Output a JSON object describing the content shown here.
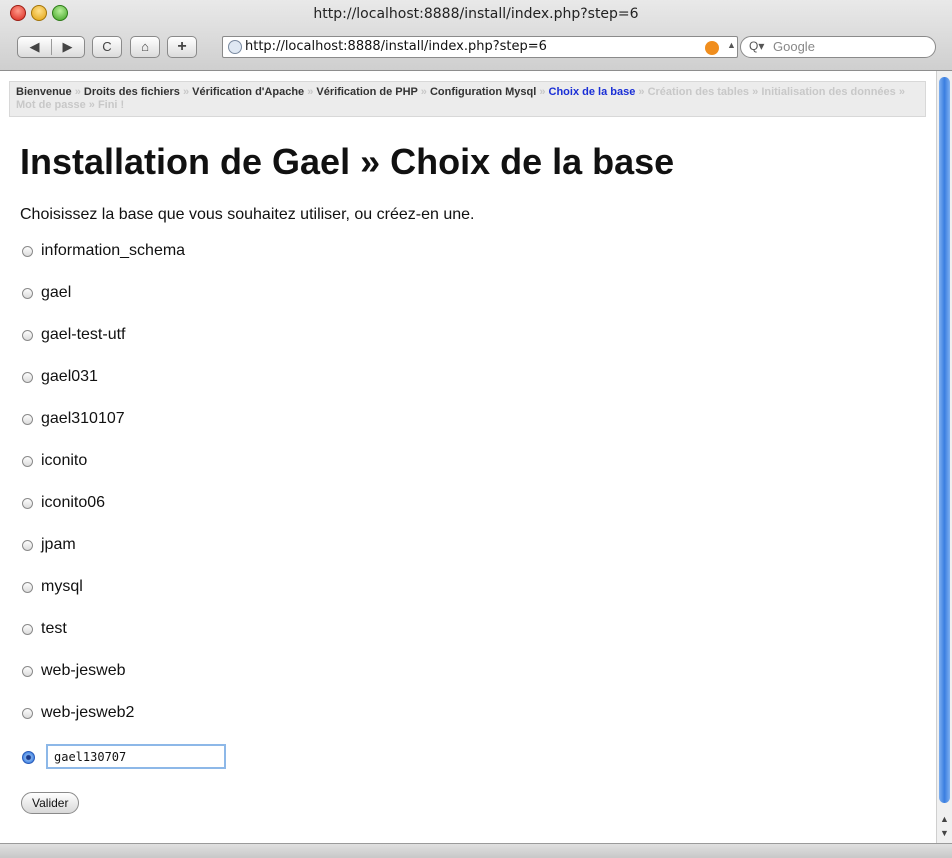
{
  "browser": {
    "window_title": "http://localhost:8888/install/index.php?step=6",
    "url": "http://localhost:8888/install/index.php?step=6",
    "search_placeholder": "Google",
    "back_glyph": "◀",
    "forward_glyph": "▶",
    "reload_glyph": "C",
    "home_glyph": "⌂",
    "add_glyph": "+"
  },
  "breadcrumb": {
    "items": [
      {
        "label": "Bienvenue",
        "state": "done"
      },
      {
        "label": "Droits des fichiers",
        "state": "done"
      },
      {
        "label": "Vérification d'Apache",
        "state": "done"
      },
      {
        "label": "Vérification de PHP",
        "state": "done"
      },
      {
        "label": "Configuration Mysql",
        "state": "done"
      },
      {
        "label": "Choix de la base",
        "state": "current"
      },
      {
        "label": "Création des tables",
        "state": "future"
      },
      {
        "label": "Initialisation des données",
        "state": "future"
      },
      {
        "label": "Mot de passe",
        "state": "future"
      },
      {
        "label": "Fini !",
        "state": "future"
      }
    ],
    "separator": "»"
  },
  "page": {
    "title": "Installation de Gael » Choix de la base",
    "intro": "Choisissez la base que vous souhaitez utiliser, ou créez-en une."
  },
  "databases": [
    "information_schema",
    "gael",
    "gael-test-utf",
    "gael031",
    "gael310107",
    "iconito",
    "iconito06",
    "jpam",
    "mysql",
    "test",
    "web-jesweb",
    "web-jesweb2"
  ],
  "new_database": {
    "value": "gael130707",
    "selected": true
  },
  "submit_label": "Valider",
  "colors": {
    "current_step": "#1a2fd6",
    "future_step": "#c8c8c8",
    "scroll_thumb": "#3a7ee0"
  }
}
